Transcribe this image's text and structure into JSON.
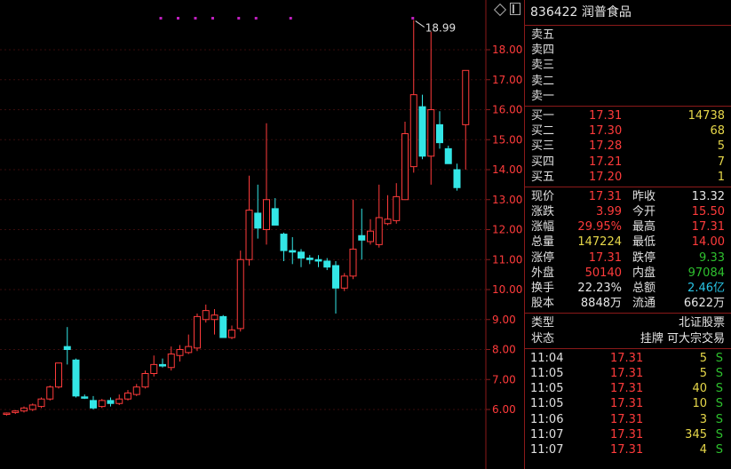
{
  "stock": {
    "title": "836422 润普食品"
  },
  "chart_data": {
    "type": "candlestick",
    "y_ticks": [
      "18.00",
      "17.00",
      "16.00",
      "15.00",
      "14.00",
      "13.00",
      "12.00",
      "11.00",
      "10.00",
      "9.00",
      "8.00",
      "7.00",
      "6.00"
    ],
    "ylim": [
      5.0,
      19.5
    ],
    "max_label": "18.99",
    "candles": [
      {
        "o": 5.85,
        "h": 5.9,
        "l": 5.8,
        "c": 5.88
      },
      {
        "o": 5.9,
        "h": 5.98,
        "l": 5.85,
        "c": 5.95
      },
      {
        "o": 5.95,
        "h": 6.1,
        "l": 5.9,
        "c": 6.05
      },
      {
        "o": 6.0,
        "h": 6.2,
        "l": 5.95,
        "c": 6.15
      },
      {
        "o": 6.1,
        "h": 6.4,
        "l": 6.05,
        "c": 6.35
      },
      {
        "o": 6.35,
        "h": 6.8,
        "l": 6.3,
        "c": 6.75
      },
      {
        "o": 6.75,
        "h": 7.4,
        "l": 6.7,
        "c": 7.55
      },
      {
        "o": 8.1,
        "h": 8.75,
        "l": 7.5,
        "c": 8.0
      },
      {
        "o": 7.65,
        "h": 7.7,
        "l": 6.4,
        "c": 6.45
      },
      {
        "o": 6.42,
        "h": 6.5,
        "l": 6.35,
        "c": 6.4
      },
      {
        "o": 6.3,
        "h": 6.45,
        "l": 6.0,
        "c": 6.05
      },
      {
        "o": 6.1,
        "h": 6.35,
        "l": 6.05,
        "c": 6.3
      },
      {
        "o": 6.3,
        "h": 6.4,
        "l": 6.1,
        "c": 6.2
      },
      {
        "o": 6.2,
        "h": 6.5,
        "l": 6.15,
        "c": 6.35
      },
      {
        "o": 6.35,
        "h": 6.65,
        "l": 6.3,
        "c": 6.55
      },
      {
        "o": 6.5,
        "h": 6.85,
        "l": 6.45,
        "c": 6.75
      },
      {
        "o": 6.75,
        "h": 7.3,
        "l": 6.7,
        "c": 7.2
      },
      {
        "o": 7.2,
        "h": 7.8,
        "l": 7.1,
        "c": 7.5
      },
      {
        "o": 7.5,
        "h": 7.7,
        "l": 7.4,
        "c": 7.45
      },
      {
        "o": 7.4,
        "h": 8.1,
        "l": 7.3,
        "c": 7.85
      },
      {
        "o": 7.8,
        "h": 8.15,
        "l": 7.6,
        "c": 8.0
      },
      {
        "o": 7.9,
        "h": 8.5,
        "l": 7.85,
        "c": 8.1
      },
      {
        "o": 8.05,
        "h": 9.2,
        "l": 7.95,
        "c": 9.1
      },
      {
        "o": 9.0,
        "h": 9.5,
        "l": 8.9,
        "c": 9.3
      },
      {
        "o": 9.0,
        "h": 9.35,
        "l": 8.5,
        "c": 9.15
      },
      {
        "o": 9.1,
        "h": 9.15,
        "l": 8.4,
        "c": 8.4
      },
      {
        "o": 8.4,
        "h": 8.8,
        "l": 8.35,
        "c": 8.65
      },
      {
        "o": 8.7,
        "h": 11.3,
        "l": 8.6,
        "c": 11.0
      },
      {
        "o": 11.0,
        "h": 13.8,
        "l": 10.8,
        "c": 12.65
      },
      {
        "o": 12.55,
        "h": 13.5,
        "l": 11.7,
        "c": 12.05
      },
      {
        "o": 12.0,
        "h": 15.55,
        "l": 11.5,
        "c": 13.0
      },
      {
        "o": 12.7,
        "h": 13.05,
        "l": 12.2,
        "c": 12.15
      },
      {
        "o": 11.85,
        "h": 11.9,
        "l": 10.95,
        "c": 11.3
      },
      {
        "o": 11.3,
        "h": 11.75,
        "l": 10.85,
        "c": 11.25
      },
      {
        "o": 11.25,
        "h": 11.35,
        "l": 10.75,
        "c": 11.05
      },
      {
        "o": 11.05,
        "h": 11.15,
        "l": 10.85,
        "c": 11.0
      },
      {
        "o": 11.0,
        "h": 11.15,
        "l": 10.75,
        "c": 10.95
      },
      {
        "o": 10.95,
        "h": 11.05,
        "l": 10.65,
        "c": 10.75
      },
      {
        "o": 10.8,
        "h": 10.95,
        "l": 9.2,
        "c": 10.05
      },
      {
        "o": 10.05,
        "h": 10.55,
        "l": 9.95,
        "c": 10.45
      },
      {
        "o": 10.45,
        "h": 13.0,
        "l": 10.35,
        "c": 11.35
      },
      {
        "o": 11.8,
        "h": 12.7,
        "l": 11.0,
        "c": 11.65
      },
      {
        "o": 11.6,
        "h": 12.35,
        "l": 11.5,
        "c": 11.95
      },
      {
        "o": 11.5,
        "h": 13.5,
        "l": 11.4,
        "c": 12.4
      },
      {
        "o": 12.2,
        "h": 13.15,
        "l": 12.15,
        "c": 12.35
      },
      {
        "o": 12.3,
        "h": 13.55,
        "l": 12.2,
        "c": 13.1
      },
      {
        "o": 13.0,
        "h": 15.6,
        "l": 13.0,
        "c": 15.2
      },
      {
        "o": 14.1,
        "h": 18.99,
        "l": 13.9,
        "c": 16.5
      },
      {
        "o": 16.1,
        "h": 16.5,
        "l": 14.35,
        "c": 14.45
      },
      {
        "o": 14.45,
        "h": 18.6,
        "l": 13.5,
        "c": 16.0
      },
      {
        "o": 15.5,
        "h": 15.95,
        "l": 14.7,
        "c": 14.9
      },
      {
        "o": 14.7,
        "h": 14.8,
        "l": 14.2,
        "c": 14.2
      },
      {
        "o": 14.0,
        "h": 14.2,
        "l": 13.3,
        "c": 13.4
      },
      {
        "o": 15.5,
        "h": 17.31,
        "l": 14.0,
        "c": 17.31
      }
    ],
    "markers": [
      8,
      10,
      12,
      14,
      17,
      19,
      23
    ]
  },
  "panel": {
    "sell": [
      {
        "label": "卖五"
      },
      {
        "label": "卖四"
      },
      {
        "label": "卖三"
      },
      {
        "label": "卖二"
      },
      {
        "label": "卖一"
      }
    ],
    "buy": [
      {
        "label": "买一",
        "price": "17.31",
        "vol": "14738"
      },
      {
        "label": "买二",
        "price": "17.30",
        "vol": "68"
      },
      {
        "label": "买三",
        "price": "17.28",
        "vol": "5"
      },
      {
        "label": "买四",
        "price": "17.21",
        "vol": "7"
      },
      {
        "label": "买五",
        "price": "17.20",
        "vol": "1"
      }
    ],
    "stats": [
      {
        "l1": "现价",
        "v1": "17.31",
        "l2": "昨收",
        "v2": "13.32"
      },
      {
        "l1": "涨跌",
        "v1": "3.99",
        "l2": "今开",
        "v2": "15.50"
      },
      {
        "l1": "涨幅",
        "v1": "29.95%",
        "l2": "最高",
        "v2": "17.31"
      },
      {
        "l1": "总量",
        "v1": "147224",
        "l2": "最低",
        "v2": "14.00"
      },
      {
        "l1": "涨停",
        "v1": "17.31",
        "l2": "跌停",
        "v2": "9.33"
      },
      {
        "l1": "外盘",
        "v1": "50140",
        "l2": "内盘",
        "v2": "97084"
      },
      {
        "l1": "换手",
        "v1": "22.23%",
        "l2": "总额",
        "v2": "2.46亿"
      },
      {
        "l1": "股本",
        "v1": "8848万",
        "l2": "流通",
        "v2": "6622万"
      }
    ],
    "info": [
      {
        "label": "类型",
        "value": "北证股票"
      },
      {
        "label": "状态",
        "value": "挂牌  可大宗交易"
      }
    ],
    "trades": [
      {
        "time": "11:04",
        "price": "17.31",
        "vol": "5",
        "side": "S"
      },
      {
        "time": "11:05",
        "price": "17.31",
        "vol": "5",
        "side": "S"
      },
      {
        "time": "11:05",
        "price": "17.31",
        "vol": "40",
        "side": "S"
      },
      {
        "time": "11:05",
        "price": "17.31",
        "vol": "10",
        "side": "S"
      },
      {
        "time": "11:06",
        "price": "17.31",
        "vol": "3",
        "side": "S"
      },
      {
        "time": "11:07",
        "price": "17.31",
        "vol": "345",
        "side": "S"
      },
      {
        "time": "11:07",
        "price": "17.31",
        "vol": "4",
        "side": "S"
      }
    ]
  },
  "colors": {
    "up": "#ff3b3b",
    "down": "#33e6e6",
    "grid": "#3a0d0d",
    "axis": "#8b1a1a",
    "marker": "#c020c0"
  }
}
